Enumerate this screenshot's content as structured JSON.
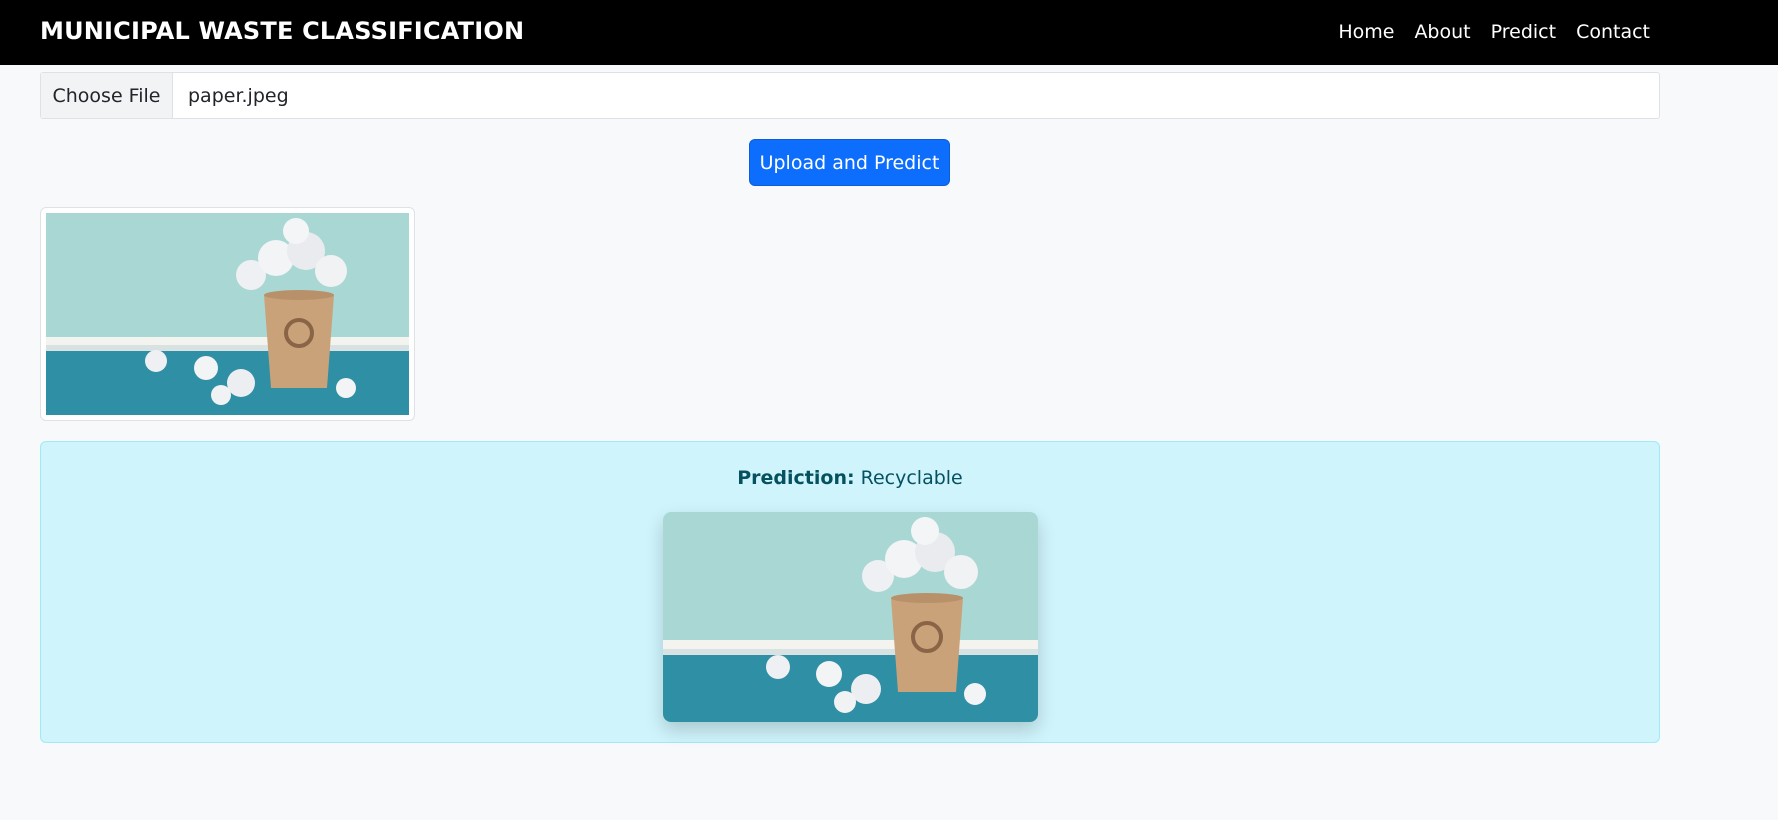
{
  "navbar": {
    "brand": "MUNICIPAL WASTE CLASSIFICATION",
    "links": [
      "Home",
      "About",
      "Predict",
      "Contact"
    ]
  },
  "upload": {
    "choose_label": "Choose File",
    "file_name": "paper.jpeg",
    "button_label": "Upload and Predict"
  },
  "result": {
    "label": "Prediction:",
    "value": "Recyclable"
  },
  "colors": {
    "navbar_bg": "#000000",
    "primary": "#0d6efd",
    "alert_bg": "#cff4fc",
    "alert_text": "#055160"
  }
}
